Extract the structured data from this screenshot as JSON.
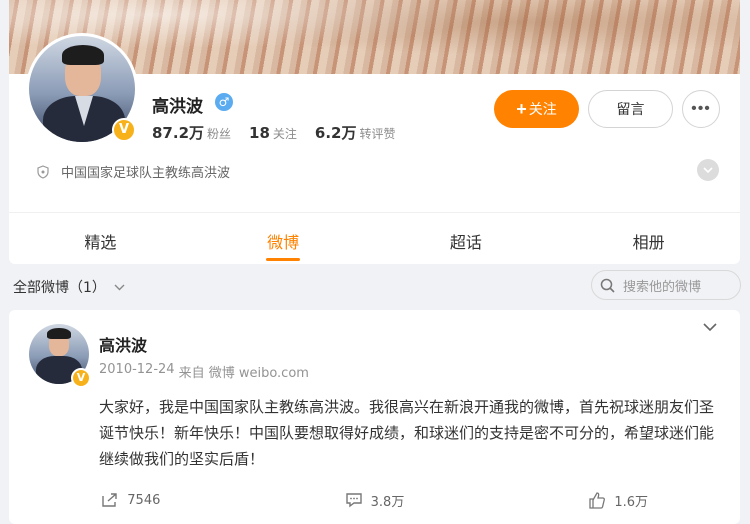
{
  "profile": {
    "name": "高洪波",
    "gender_icon": "♂",
    "verified_icon": "V",
    "stats": [
      {
        "num": "87.2万",
        "label": "粉丝"
      },
      {
        "num": "18",
        "label": "关注"
      },
      {
        "num": "6.2万",
        "label": "转评赞"
      }
    ],
    "follow_label": "关注",
    "message_label": "留言",
    "more_label": "•••",
    "description": "中国国家足球队主教练高洪波"
  },
  "tabs": [
    "精选",
    "微博",
    "超话",
    "相册"
  ],
  "active_tab": 1,
  "filter": {
    "label": "全部微博（1）",
    "search_placeholder": "搜索他的微博"
  },
  "post": {
    "author": "高洪波",
    "date": "2010-12-24",
    "source": "来自 微博 weibo.com",
    "text": "大家好，我是中国国家队主教练高洪波。我很高兴在新浪开通我的微博，首先祝球迷朋友们圣诞节快乐！新年快乐！中国队要想取得好成绩，和球迷们的支持是密不可分的，希望球迷们能继续做我们的坚实后盾！",
    "reposts": "7546",
    "comments": "3.8万",
    "likes": "1.6万"
  },
  "colors": {
    "accent": "#ff8200",
    "verified": "#f7b21b",
    "gender": "#5aabf0"
  }
}
